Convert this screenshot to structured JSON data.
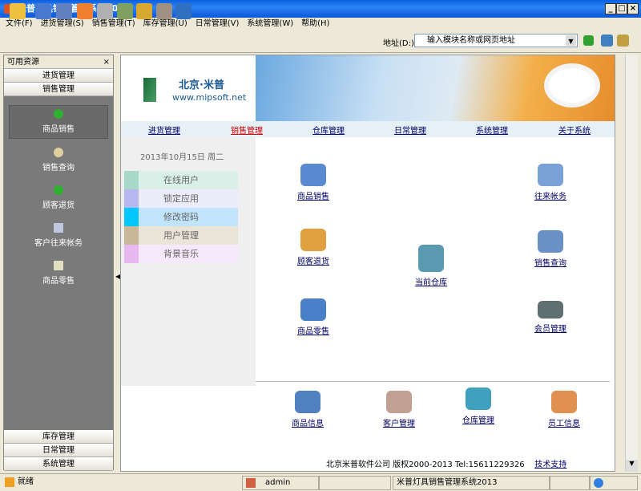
{
  "window": {
    "title": "米普灯具销售管理系统2013"
  },
  "menu": [
    "文件(F)",
    "进货管理(S)",
    "销售管理(T)",
    "库存管理(U)",
    "日常管理(V)",
    "系统管理(W)",
    "帮助(H)"
  ],
  "toolbar": {
    "icons": [
      "open-icon",
      "list-icon",
      "computer-icon",
      "home-icon",
      "print-icon",
      "keys-icon",
      "lock-icon",
      "user-lock-icon",
      "exit-icon"
    ],
    "address_label": "地址(D:)",
    "address_placeholder": "输入模块名称或网页地址"
  },
  "left": {
    "title": "可用资源",
    "close": "×",
    "top_groups": [
      "进货管理",
      "销售管理"
    ],
    "items": [
      "商品销售",
      "销售查询",
      "顾客退货",
      "客户往来帐务",
      "商品零售"
    ],
    "bottom_groups": [
      "库存管理",
      "日常管理",
      "系统管理"
    ]
  },
  "main": {
    "logo": {
      "cn": "北京·米普",
      "url": "www.mipsoft.net"
    },
    "nav": [
      "进货管理",
      "销售管理",
      "仓库管理",
      "日常管理",
      "系统管理",
      "关于系统"
    ],
    "active_nav": "销售管理",
    "date": "2013年10月15日  周二",
    "side_buttons": [
      {
        "label": "在线用户",
        "color": "#a8d8c8"
      },
      {
        "label": "锁定应用",
        "color": "#b8b8f0"
      },
      {
        "label": "修改密码",
        "color": "#00c8ff"
      },
      {
        "label": "用户管理",
        "color": "#c8b898"
      },
      {
        "label": "背景音乐",
        "color": "#e8b8f0"
      }
    ],
    "modules": [
      "商品销售",
      "往来帐务",
      "顾客退货",
      "当前仓库",
      "销售查询",
      "商品零售",
      "会员管理"
    ],
    "bottom_modules": [
      "商品信息",
      "客户管理",
      "仓库管理",
      "员工信息"
    ],
    "footer": {
      "text": "北京米普软件公司 版权2000-2013  Tel:15611229326",
      "link": "技术支持"
    }
  },
  "status": {
    "ready": "就绪",
    "user": "admin",
    "app": "米普灯具销售管理系统2013"
  }
}
